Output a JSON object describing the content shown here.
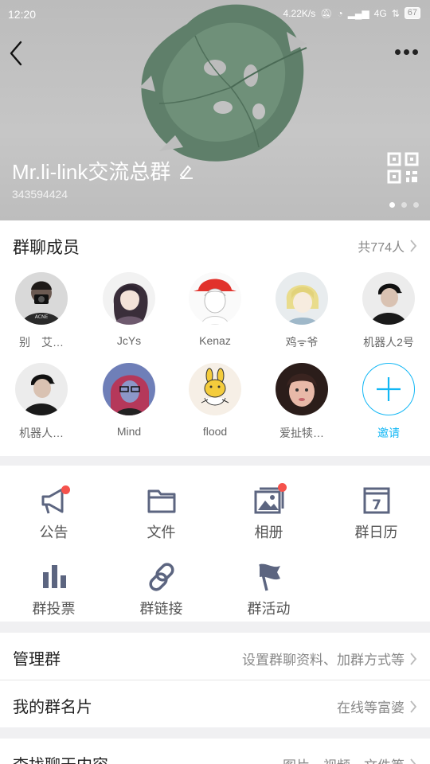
{
  "status_bar": {
    "time": "12:20",
    "net_speed": "4.22K/s",
    "network": "4G",
    "battery": "67"
  },
  "header": {
    "group_name": "Mr.li-link交流总群",
    "group_id": "343594424",
    "background_image": "monstera-leaf-watercolor"
  },
  "members": {
    "title": "群聊成员",
    "count": "共774人",
    "list": [
      {
        "name": "别　艾…",
        "avatar": "man-with-camera"
      },
      {
        "name": "JcYs",
        "avatar": "anime-dark-hair"
      },
      {
        "name": "Kenaz",
        "avatar": "anime-red-hat"
      },
      {
        "name": "鸡ᯤ爷",
        "avatar": "anime-blond"
      },
      {
        "name": "机器人2号",
        "avatar": "man-black-cap"
      },
      {
        "name": "机器人…",
        "avatar": "man-black-cap"
      },
      {
        "name": "Mind",
        "avatar": "illustration-red-hair"
      },
      {
        "name": "flood",
        "avatar": "cartoon-rabbit"
      },
      {
        "name": "爱扯犊…",
        "avatar": "girl-photo"
      }
    ],
    "invite_label": "邀请"
  },
  "features": [
    {
      "label": "公告",
      "icon": "megaphone-icon",
      "badge": true
    },
    {
      "label": "文件",
      "icon": "folder-icon",
      "badge": false
    },
    {
      "label": "相册",
      "icon": "album-icon",
      "badge": true
    },
    {
      "label": "群日历",
      "icon": "calendar-icon",
      "badge": false,
      "calendar_day": "7"
    },
    {
      "label": "群投票",
      "icon": "vote-chart-icon",
      "badge": false
    },
    {
      "label": "群链接",
      "icon": "link-icon",
      "badge": false
    },
    {
      "label": "群活动",
      "icon": "flag-icon",
      "badge": false
    }
  ],
  "rows": {
    "manage": {
      "label": "管理群",
      "value": "设置群聊资料、加群方式等"
    },
    "card": {
      "label": "我的群名片",
      "value": "在线等富婆"
    },
    "search": {
      "label": "查找聊天内容",
      "value": "图片、视频、文件等"
    }
  },
  "colors": {
    "accent": "#12b7f5",
    "badge": "#f5524c",
    "icon": "#5c6580"
  }
}
